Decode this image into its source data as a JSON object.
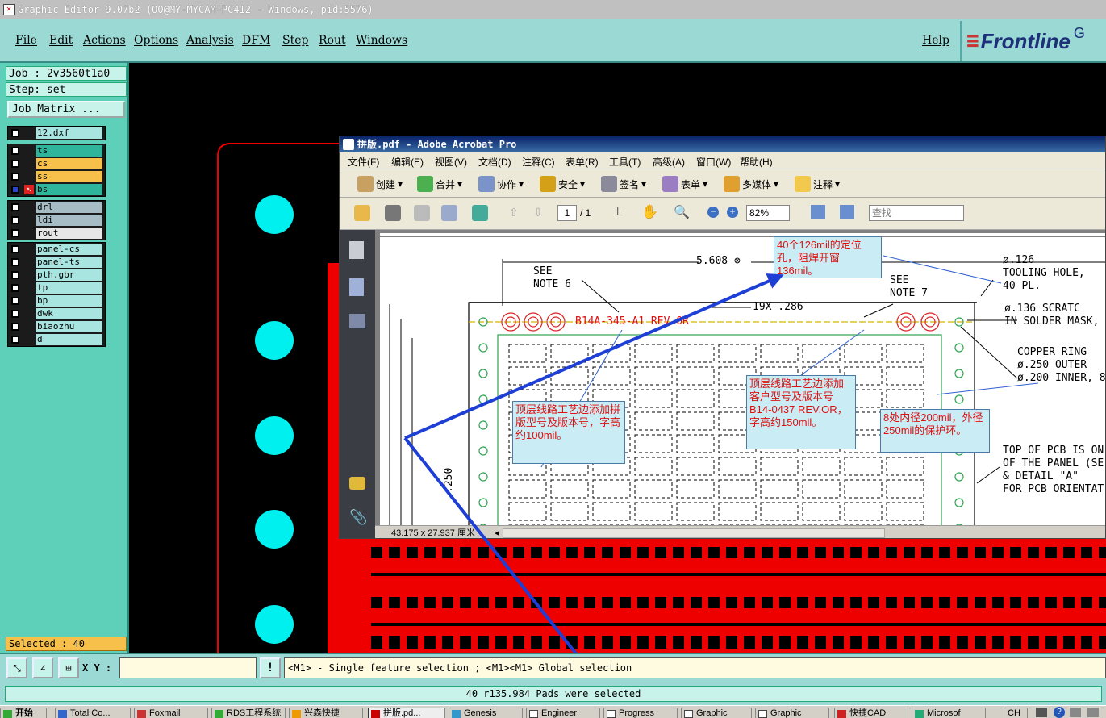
{
  "window": {
    "title": "Graphic Editor 9.07b2 (OO@MY-MYCAM-PC412 - Windows, pid:5576)"
  },
  "menu": {
    "items": [
      "File",
      "Edit",
      "Actions",
      "Options",
      "Analysis",
      "DFM",
      "Step",
      "Rout",
      "Windows"
    ],
    "help": "Help",
    "logo": "Frontline",
    "logo_tail": "G"
  },
  "left": {
    "job": "Job : 2v3560t1a0",
    "step": "Step: set",
    "job_matrix": "Job Matrix ...",
    "layers_top": [
      {
        "name": "12.dxf",
        "color": "#a9e5e0"
      }
    ],
    "layers_mid": [
      {
        "name": "ts",
        "color": "#2fb59c"
      },
      {
        "name": "cs",
        "color": "#f7c04a"
      },
      {
        "name": "ss",
        "color": "#f7c04a"
      },
      {
        "name": "bs",
        "color": "#2fb59c"
      }
    ],
    "layers_drill": [
      {
        "name": "drl",
        "color": "#a7bdc6"
      },
      {
        "name": "ldi",
        "color": "#a7bdc6"
      },
      {
        "name": "rout",
        "color": "#e6e6e6"
      }
    ],
    "layers_misc": [
      {
        "name": "panel-cs",
        "color": "#a9e5e0"
      },
      {
        "name": "panel-ts",
        "color": "#a9e5e0"
      },
      {
        "name": "pth.gbr",
        "color": "#a9e5e0"
      },
      {
        "name": "tp",
        "color": "#a9e5e0"
      },
      {
        "name": "bp",
        "color": "#a9e5e0"
      },
      {
        "name": "dwk",
        "color": "#a9e5e0"
      },
      {
        "name": "biaozhu",
        "color": "#a9e5e0"
      },
      {
        "name": "d",
        "color": "#a9e5e0"
      }
    ],
    "selected": "Selected : 40"
  },
  "cmd": {
    "xy_label": "X Y :",
    "xy_value": "",
    "excl": "!",
    "hint": "<M1> - Single feature selection ; <M1><M1> Global selection"
  },
  "status": "40 r135.984 Pads were selected",
  "acrobat": {
    "title": "拼版.pdf - Adobe Acrobat Pro",
    "menu": [
      "文件(F)",
      "编辑(E)",
      "视图(V)",
      "文档(D)",
      "注释(C)",
      "表单(R)",
      "工具(T)",
      "高级(A)",
      "窗口(W)",
      "帮助(H)"
    ],
    "tools": [
      "创建",
      "合并",
      "协作",
      "安全",
      "签名",
      "表单",
      "多媒体",
      "注释"
    ],
    "page_num": "1",
    "page_total": "/ 1",
    "zoom": "82%",
    "find": "查找",
    "page_size": "43.175 x 27.937 厘米",
    "drawing": {
      "dim1": "5.608 ⊗",
      "see6": "SEE\nNOTE 6",
      "see7": "SEE\nNOTE 7",
      "dim2": "19X .286",
      "partno": "B14A-345-A1 REV OR",
      "tooling": "ø.126\nTOOLING HOLE,\n40 PL.",
      "scratch": "ø.136 SCRATC\nIN SOLDER MASK,",
      "copper": "COPPER RING\nø.250 OUTER\nø.200 INNER, 8",
      "topnote": "TOP OF PCB IS ON\nOF THE PANEL (SE\n& DETAIL \"A\"\nFOR PCB ORIENTAT",
      "vdim": ".250"
    },
    "notes": {
      "n1": "40个126mil的定位孔，阻焊开窗136mil。",
      "n2": "顶层线路工艺边添加拼版型号及版本号，字高约100mil。",
      "n3": "顶层线路工艺边添加客户型号及版本号B14-0437 REV.OR，字高约150mil。",
      "n4": "8处内径200mil，外径250mil的保护环。"
    }
  },
  "taskbar": [
    "开始",
    "Total Co...",
    "Foxmail",
    "RDS工程系统",
    "兴森快捷",
    "拼版.pd...",
    "Genesis",
    "Engineer",
    "Progress",
    "Graphic",
    "Graphic",
    "快捷CAD",
    "Microsof",
    "CH"
  ]
}
